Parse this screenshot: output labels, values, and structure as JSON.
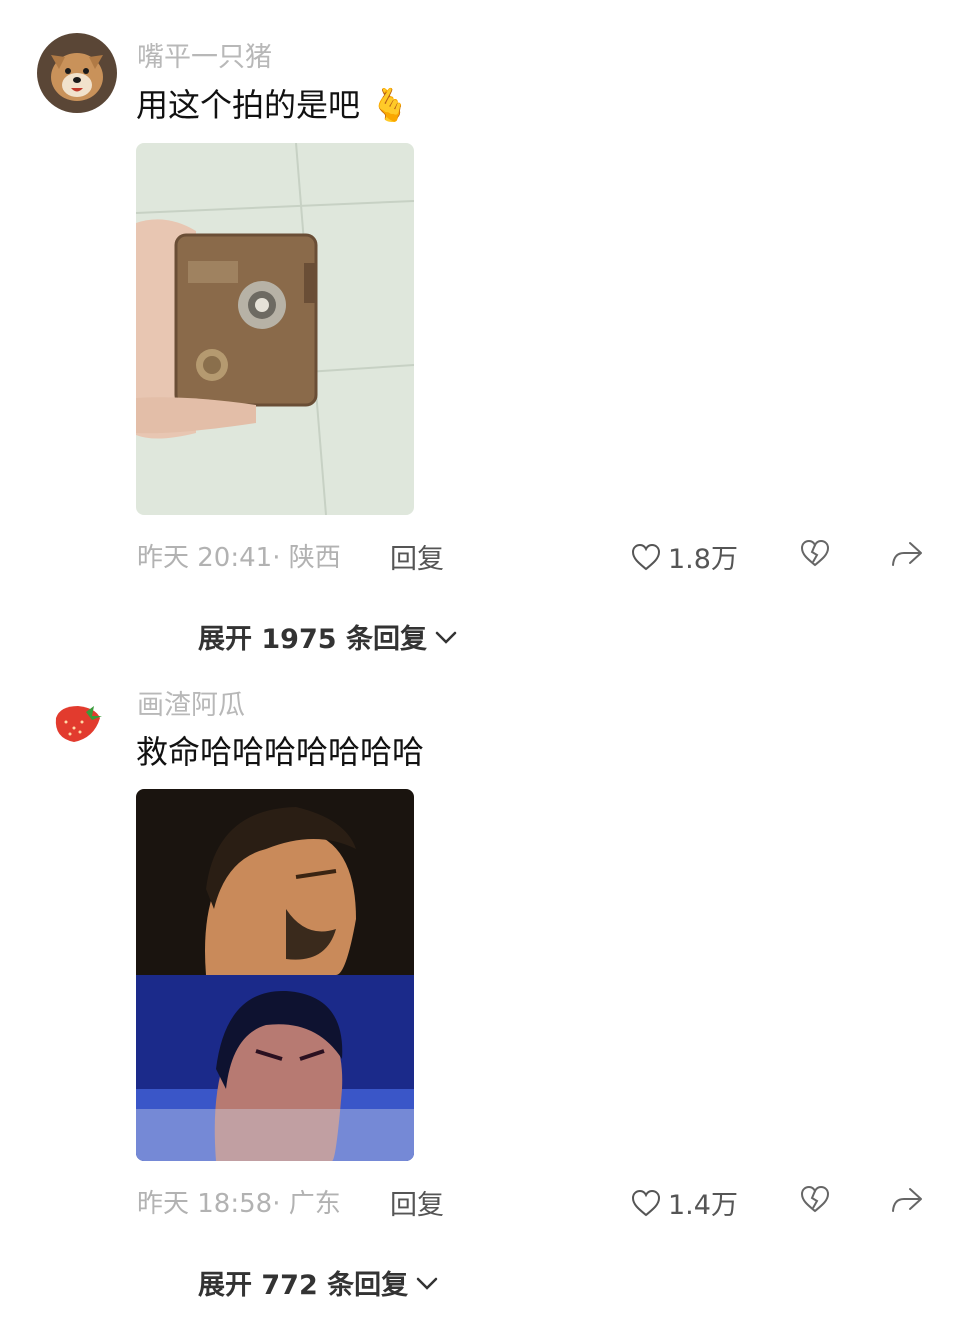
{
  "comments": [
    {
      "username": "嘴平一只猪",
      "text": "用这个拍的是吧",
      "emoji": "🫰",
      "time": "昨天 20:41",
      "location": "陕西",
      "reply_label": "回复",
      "likes": "1.8万",
      "expand_label": "展开 1975 条回复",
      "avatar_icon": "dog-avatar",
      "media_desc": "hand-holding-old-camera"
    },
    {
      "username": "画渣阿瓜",
      "text": "救命哈哈哈哈哈哈哈",
      "time": "昨天 18:58",
      "location": "广东",
      "reply_label": "回复",
      "likes": "1.4万",
      "expand_label": "展开 772 条回复",
      "avatar_icon": "strawberry-icon",
      "media_desc": "two-stacked-meme-faces"
    }
  ],
  "colors": {
    "username": "#b8b8b8",
    "text": "#111111",
    "meta": "#b2b2b2",
    "action": "#555555"
  }
}
